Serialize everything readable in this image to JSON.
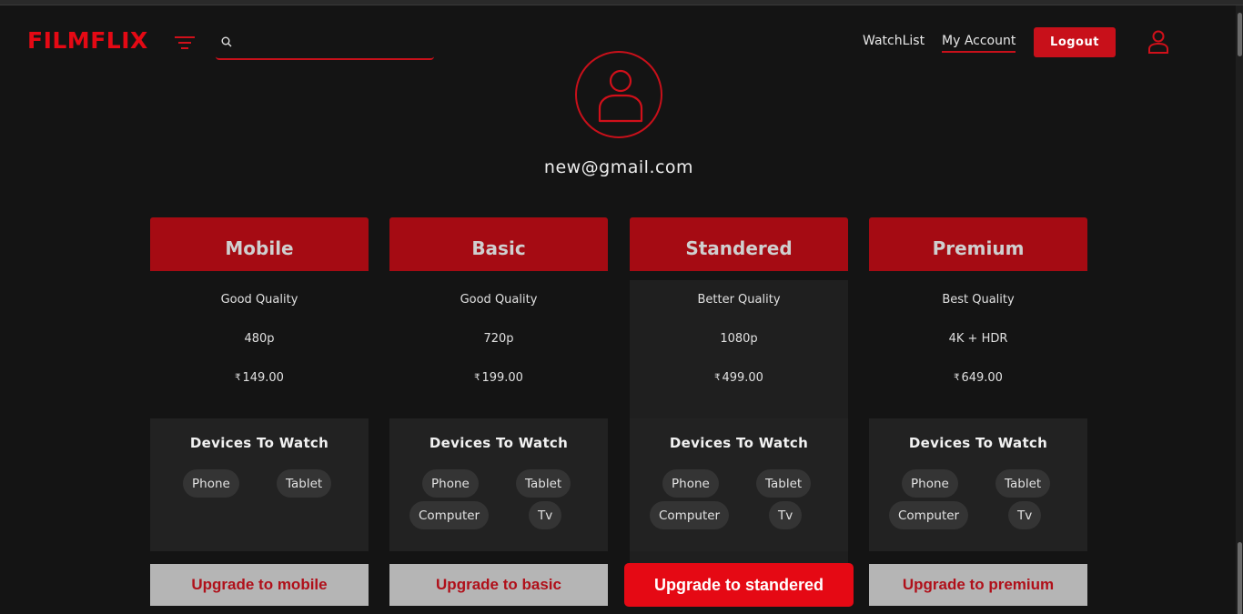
{
  "header": {
    "logo": "FILMFLIX",
    "search": {
      "value": "",
      "placeholder": ""
    },
    "nav": {
      "watchlist": "WatchList",
      "my_account": "My Account"
    },
    "logout_label": "Logout",
    "icons": [
      "filter-icon",
      "search-icon",
      "user-icon"
    ]
  },
  "profile": {
    "email": "new@gmail.com",
    "icon": "user-avatar-icon"
  },
  "plans": [
    {
      "name": "Mobile",
      "quality": "Good Quality",
      "resolution": "480p",
      "currency": "₹",
      "price": "149.00",
      "devices_title": "Devices To Watch",
      "devices": [
        "Phone",
        "Tablet"
      ],
      "button": "Upgrade to mobile",
      "active": false
    },
    {
      "name": "Basic",
      "quality": "Good Quality",
      "resolution": "720p",
      "currency": "₹",
      "price": "199.00",
      "devices_title": "Devices To Watch",
      "devices": [
        "Phone",
        "Tablet",
        "Computer",
        "Tv"
      ],
      "button": "Upgrade to basic",
      "active": false
    },
    {
      "name": "Standered",
      "quality": "Better Quality",
      "resolution": "1080p",
      "currency": "₹",
      "price": "499.00",
      "devices_title": "Devices To Watch",
      "devices": [
        "Phone",
        "Tablet",
        "Computer",
        "Tv"
      ],
      "button": "Upgrade to standered",
      "active": true
    },
    {
      "name": "Premium",
      "quality": "Best Quality",
      "resolution": "4K + HDR",
      "currency": "₹",
      "price": "649.00",
      "devices_title": "Devices To Watch",
      "devices": [
        "Phone",
        "Tablet",
        "Computer",
        "Tv"
      ],
      "button": "Upgrade to premium",
      "active": false
    }
  ],
  "colors": {
    "accent": "#e50914",
    "header_red": "#a50b13",
    "background": "#141414"
  }
}
